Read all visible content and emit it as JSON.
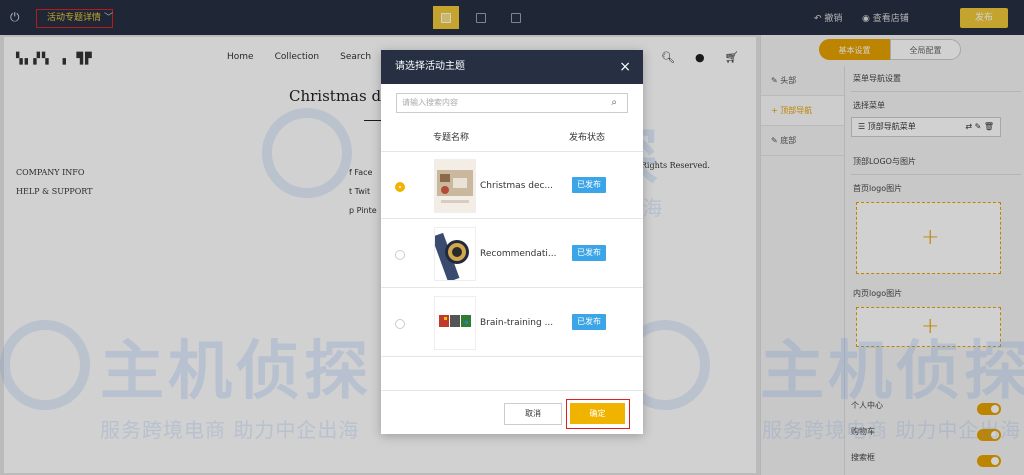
{
  "topbar": {
    "exit_icon": "exit-icon",
    "page_select": "活动专题详情",
    "devices": [
      "desktop",
      "tablet",
      "mobile"
    ],
    "undo_label": "撤销",
    "view_store_label": "查看店铺",
    "publish_label": "发布"
  },
  "store": {
    "logo_text": "▚▖▞▚ ▗ ▜▛",
    "nav": [
      "Home",
      "Collection",
      "Search"
    ],
    "hero_title": "Christmas d",
    "footer_links": [
      "COMPANY INFO",
      "HELP & SUPPORT"
    ],
    "social": [
      "f  Face",
      "t  Twit",
      "p  Pinte"
    ],
    "copyright": "NC. ALL Rights Reserved."
  },
  "sidebar": {
    "tabs": [
      "基本设置",
      "全局配置"
    ],
    "nav": [
      "头部",
      "顶部导航",
      "底部"
    ],
    "section_nav": "菜单导航设置",
    "menu_label": "选择菜单",
    "menu_value": "顶部导航菜单",
    "section_logo": "顶部LOGO与图片",
    "home_logo_label": "首页logo图片",
    "inner_logo_label": "内页logo图片",
    "toggles": [
      "个人中心",
      "购物车",
      "搜索框"
    ]
  },
  "modal": {
    "title": "请选择活动主题",
    "search_placeholder": "请输入搜索内容",
    "col_name": "专题名称",
    "col_status": "发布状态",
    "rows": [
      {
        "name": "Christmas dec...",
        "status": "已发布",
        "selected": true
      },
      {
        "name": "Recommendati...",
        "status": "已发布",
        "selected": false
      },
      {
        "name": "Brain-training ...",
        "status": "已发布",
        "selected": false
      }
    ],
    "cancel_label": "取消",
    "confirm_label": "确定"
  },
  "watermark": {
    "brand": "主机侦探",
    "slogan": "服务跨境电商 助力中企出海"
  },
  "colors": {
    "topbar": "#263042",
    "accent": "#f0b400",
    "badge": "#3ba5e8",
    "highlight_border": "#e02020"
  }
}
